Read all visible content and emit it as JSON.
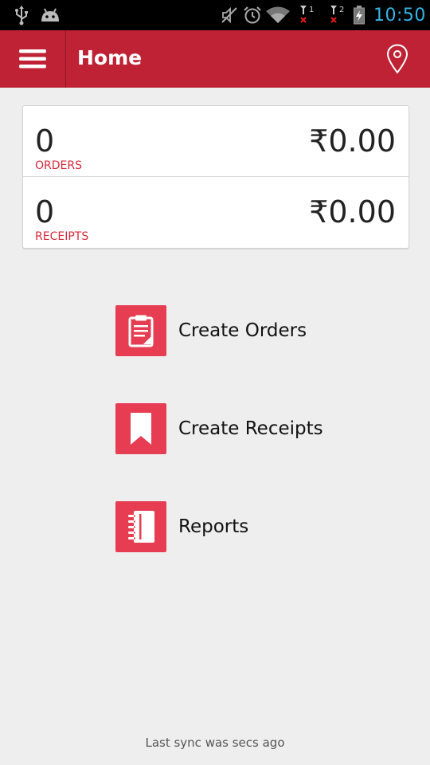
{
  "status_bar": {
    "time": "10:50",
    "sim1_label": "1",
    "sim2_label": "2",
    "time_color": "#33b5e5",
    "icons": [
      "usb-icon",
      "android-icon",
      "mute-icon",
      "alarm-icon",
      "wifi-icon",
      "sim1-no-signal-icon",
      "sim2-no-signal-icon",
      "battery-charging-icon"
    ]
  },
  "app_bar": {
    "title": "Home",
    "background": "#be2234",
    "menu_icon": "hamburger-menu-icon",
    "location_icon": "location-pin-icon"
  },
  "summary": {
    "orders": {
      "count": "0",
      "label": "ORDERS",
      "amount": "₹0.00"
    },
    "receipts": {
      "count": "0",
      "label": "RECEIPTS",
      "amount": "₹0.00"
    },
    "label_color": "#d9283b"
  },
  "actions": [
    {
      "label": "Create Orders",
      "icon": "clipboard-icon"
    },
    {
      "label": "Create Receipts",
      "icon": "bookmark-icon"
    },
    {
      "label": "Reports",
      "icon": "notebook-icon"
    }
  ],
  "action_icon_color": "#e63d52",
  "footer": {
    "sync_text": "Last sync was secs ago"
  }
}
